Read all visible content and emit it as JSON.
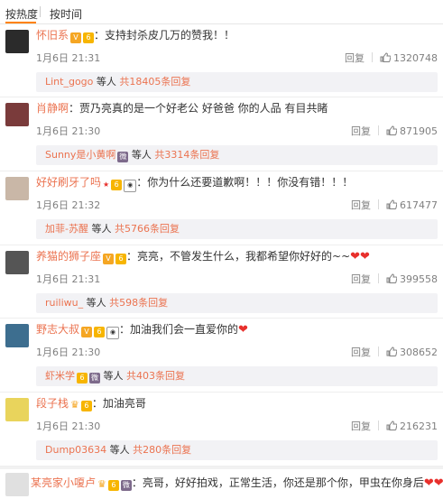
{
  "sort": {
    "hot": "按热度",
    "time": "按时间"
  },
  "comments": [
    {
      "user": "怀旧系",
      "text": "：支持封杀皮几万的赞我！！",
      "time": "1月6日 21:31",
      "reply": "回复",
      "likes": "1320748",
      "sub_user": "Lint_gogo",
      "sub_mid": " 等人 ",
      "sub_more": "共18405条回复",
      "avatar_color": "#2b2b2b"
    },
    {
      "user": "肖静啊",
      "text": "：贾乃亮真的是一个好老公 好爸爸 你的人品 有目共睹",
      "time": "1月6日 21:30",
      "reply": "回复",
      "likes": "871905",
      "sub_user": "Sunny是小黄啊",
      "sub_mid": " 等人 ",
      "sub_more": "共3314条回复",
      "avatar_color": "#7a3b3b"
    },
    {
      "user": "好好刷牙了吗",
      "text": "：你为什么还要道歉啊！！！你没有错！！！",
      "time": "1月6日 21:32",
      "reply": "回复",
      "likes": "617477",
      "sub_user": "加菲-苏醒",
      "sub_mid": " 等人 ",
      "sub_more": "共5766条回复",
      "avatar_color": "#c9b7a7"
    },
    {
      "user": "养猫的狮子座",
      "text": "：亮亮，不管发生什么，我都希望你好好的~~",
      "time": "1月6日 21:31",
      "reply": "回复",
      "likes": "399558",
      "sub_user": "ruiliwu_",
      "sub_mid": " 等人 ",
      "sub_more": "共598条回复",
      "avatar_color": "#555555"
    },
    {
      "user": "野志大叔",
      "text": "：加油我们会一直爱你的",
      "time": "1月6日 21:30",
      "reply": "回复",
      "likes": "308652",
      "sub_user": "虾米学",
      "sub_mid": " 等人 ",
      "sub_more": "共403条回复",
      "avatar_color": "#3d6e8f"
    },
    {
      "user": "段子栈",
      "text": "：加油亮哥",
      "time": "1月6日 21:30",
      "reply": "回复",
      "likes": "216231",
      "sub_user": "Dump03634",
      "sub_mid": " 等人 ",
      "sub_more": "共280条回复",
      "avatar_color": "#e9d45c"
    },
    {
      "user": "某亮家小嗄卢",
      "text": "：亮哥，好好拍戏，正常生活，你还是那个你，甲虫在你身后",
      "time": "",
      "reply": "",
      "likes": "",
      "sub_user": "",
      "sub_mid": "",
      "sub_more": "",
      "avatar_color": "#e0e0e0"
    }
  ]
}
